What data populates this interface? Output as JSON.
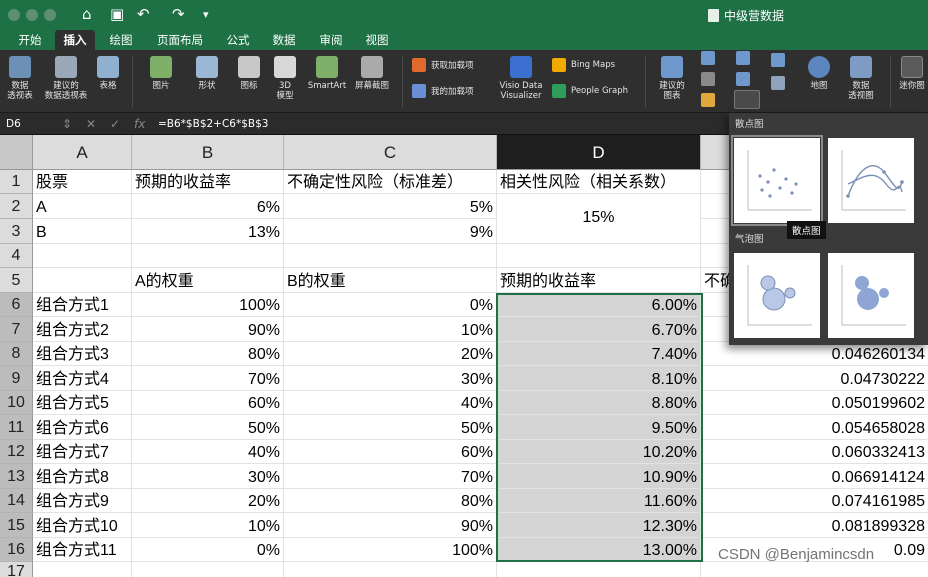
{
  "title_bar": {
    "doc_title": "中级营数据"
  },
  "ribbon_tabs": [
    "开始",
    "插入",
    "绘图",
    "页面布局",
    "公式",
    "数据",
    "审阅",
    "视图"
  ],
  "active_tab": "插入",
  "ribbon": {
    "pivot_table": "数据\n透视表",
    "recommended_pivot": "建议的\n数据透视表",
    "table": "表格",
    "picture": "图片",
    "shapes": "形状",
    "icons": "图标",
    "model3d": "3D\n模型",
    "smartart": "SmartArt",
    "screenshot": "屏幕截图",
    "get_addins": "获取加载项",
    "my_addins": "我的加载项",
    "visio": "Visio Data\nVisualizer",
    "bing_maps": "Bing Maps",
    "people_graph": "People Graph",
    "recommended_charts": "建议的\n图表",
    "map": "地图",
    "pivot_chart": "数据\n透视图",
    "sparkline": "迷你图"
  },
  "formula_bar": {
    "name_box": "D6",
    "fx": "fx",
    "formula": "=B6*$B$2+C6*$B$3"
  },
  "columns": [
    "A",
    "B",
    "C",
    "D"
  ],
  "rows": [
    {
      "n": "1",
      "A": "股票",
      "B": "预期的收益率",
      "C": "不确定性风险（标准差）",
      "D": "相关性风险（相关系数）",
      "E": ""
    },
    {
      "n": "2",
      "A": "A",
      "B": "6%",
      "C": "5%",
      "D": "15%",
      "E": ""
    },
    {
      "n": "3",
      "A": "B",
      "B": "13%",
      "C": "9%",
      "D": "",
      "E": ""
    },
    {
      "n": "4",
      "A": "",
      "B": "",
      "C": "",
      "D": "",
      "E": ""
    },
    {
      "n": "5",
      "A": "",
      "B": "A的权重",
      "C": "B的权重",
      "D": "预期的收益率",
      "E": "不确"
    },
    {
      "n": "6",
      "A": "组合方式1",
      "B": "100%",
      "C": "0%",
      "D": "6.00%",
      "E": ""
    },
    {
      "n": "7",
      "A": "组合方式2",
      "B": "90%",
      "C": "10%",
      "D": "6.70%",
      "E": ""
    },
    {
      "n": "8",
      "A": "组合方式3",
      "B": "80%",
      "C": "20%",
      "D": "7.40%",
      "E": "0.046260134"
    },
    {
      "n": "9",
      "A": "组合方式4",
      "B": "70%",
      "C": "30%",
      "D": "8.10%",
      "E": "0.04730222"
    },
    {
      "n": "10",
      "A": "组合方式5",
      "B": "60%",
      "C": "40%",
      "D": "8.80%",
      "E": "0.050199602"
    },
    {
      "n": "11",
      "A": "组合方式6",
      "B": "50%",
      "C": "50%",
      "D": "9.50%",
      "E": "0.054658028"
    },
    {
      "n": "12",
      "A": "组合方式7",
      "B": "40%",
      "C": "60%",
      "D": "10.20%",
      "E": "0.060332413"
    },
    {
      "n": "13",
      "A": "组合方式8",
      "B": "30%",
      "C": "70%",
      "D": "10.90%",
      "E": "0.066914124"
    },
    {
      "n": "14",
      "A": "组合方式9",
      "B": "20%",
      "C": "80%",
      "D": "11.60%",
      "E": "0.074161985"
    },
    {
      "n": "15",
      "A": "组合方式10",
      "B": "10%",
      "C": "90%",
      "D": "12.30%",
      "E": "0.081899328"
    },
    {
      "n": "16",
      "A": "组合方式11",
      "B": "0%",
      "C": "100%",
      "D": "13.00%",
      "E": "0.09"
    },
    {
      "n": "17",
      "A": "",
      "B": "",
      "C": "",
      "D": "",
      "E": ""
    }
  ],
  "chart_popup": {
    "scatter_section": "散点图",
    "bubble_section": "气泡图",
    "tooltip": "散点图"
  },
  "watermark": "CSDN @Benjamincsdn",
  "colors": {
    "excel_green": "#1e7145",
    "ribbon_bg": "#2f2f2f",
    "selection_fill": "#d4d4d4"
  }
}
